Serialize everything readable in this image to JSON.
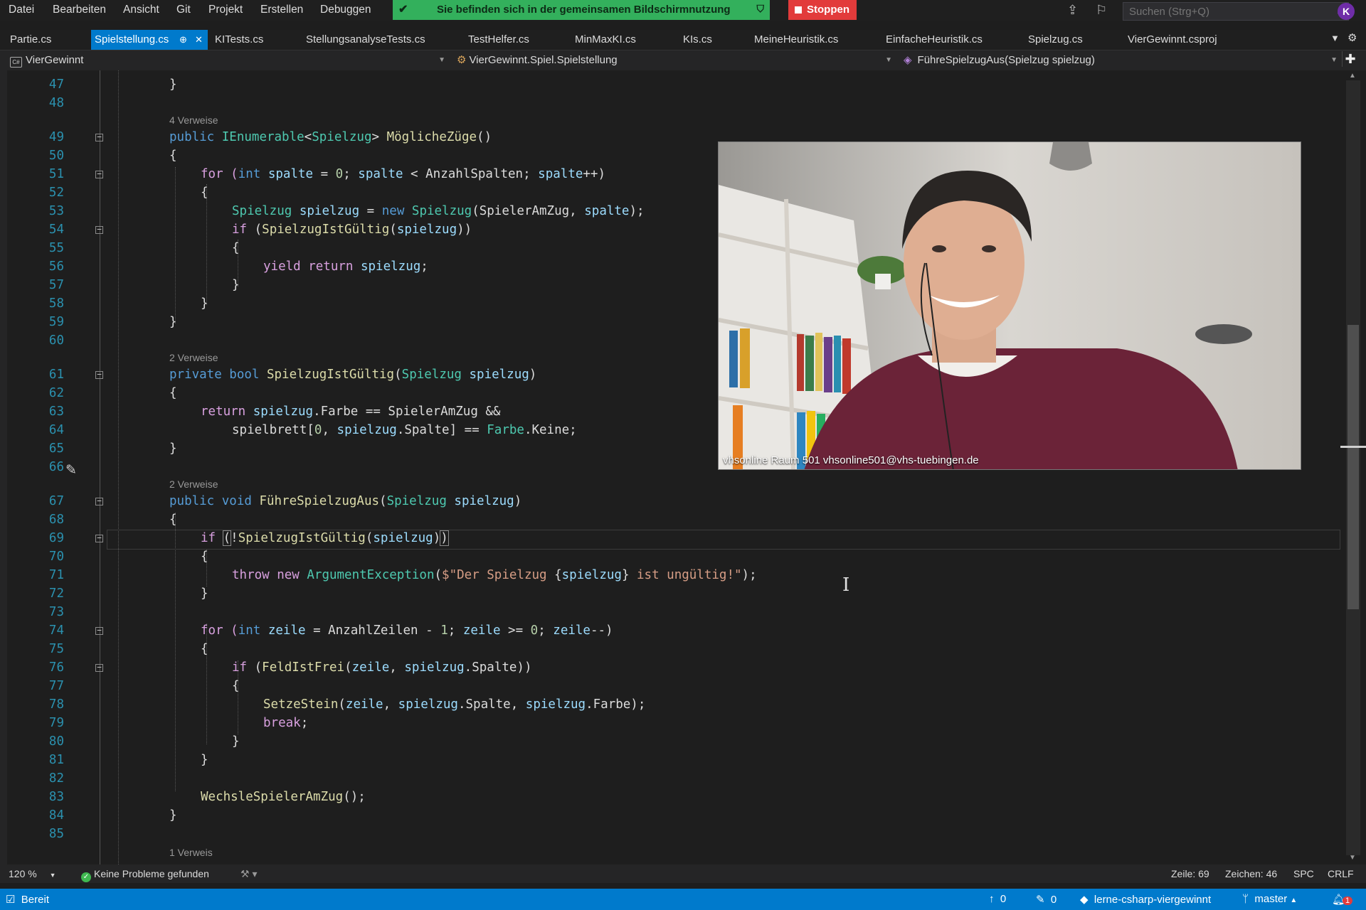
{
  "menu": [
    "Datei",
    "Bearbeiten",
    "Ansicht",
    "Git",
    "Projekt",
    "Erstellen",
    "Debuggen"
  ],
  "share_banner": {
    "text": "Sie befinden sich in der gemeinsamen Bildschirmnutzung",
    "color": "#33b05c"
  },
  "stop_button": {
    "label": "Stoppen",
    "color": "#e23b3b"
  },
  "search": {
    "placeholder": "Suchen (Strg+Q)"
  },
  "avatar": "K",
  "tabs": [
    {
      "label": "Partie.cs",
      "active": false
    },
    {
      "label": "Spielstellung.cs",
      "active": true
    },
    {
      "label": "KITests.cs",
      "active": false
    },
    {
      "label": "StellungsanalyseTests.cs",
      "active": false
    },
    {
      "label": "TestHelfer.cs",
      "active": false
    },
    {
      "label": "MinMaxKI.cs",
      "active": false
    },
    {
      "label": "KIs.cs",
      "active": false
    },
    {
      "label": "MeineHeuristik.cs",
      "active": false
    },
    {
      "label": "EinfacheHeuristik.cs",
      "active": false
    },
    {
      "label": "Spielzug.cs",
      "active": false
    },
    {
      "label": "VierGewinnt.csproj",
      "active": false
    }
  ],
  "nav": {
    "project": "VierGewinnt",
    "type": "VierGewinnt.Spiel.Spielstellung",
    "member": "FühreSpielzugAus(Spielzug spielzug)"
  },
  "editor": {
    "line_numbers": [
      "47",
      "48",
      "49",
      "50",
      "51",
      "52",
      "53",
      "54",
      "55",
      "56",
      "57",
      "58",
      "59",
      "60",
      "61",
      "62",
      "63",
      "64",
      "65",
      "66",
      "67",
      "68",
      "69",
      "70",
      "71",
      "72",
      "73",
      "74",
      "75",
      "76",
      "77",
      "78",
      "79",
      "80",
      "81",
      "82",
      "83",
      "84",
      "85"
    ],
    "codelens": [
      "4 Verweise",
      "2 Verweise",
      "2 Verweise",
      "1 Verweis"
    ],
    "code": {
      "l47": "}",
      "l49_kw": "public ",
      "l49_ty": "IEnumerable",
      "l49_lt": "<",
      "l49_ty2": "Spielzug",
      "l49_gt": "> ",
      "l49_fn": "MöglicheZüge",
      "l49_end": "()",
      "l50": "{",
      "l51_a": "for (",
      "l51_kw": "int",
      "l51_b": " ",
      "l51_v": "spalte",
      "l51_c": " = ",
      "l51_n": "0",
      "l51_d": "; ",
      "l51_v2": "spalte",
      "l51_e": " < AnzahlSpalten; ",
      "l51_v3": "spalte",
      "l51_f": "++)",
      "l52": "{",
      "l53_ty": "Spielzug",
      "l53_a": " ",
      "l53_v": "spielzug",
      "l53_b": " = ",
      "l53_kw": "new",
      "l53_c": " ",
      "l53_ty2": "Spielzug",
      "l53_d": "(SpielerAmZug, ",
      "l53_v2": "spalte",
      "l53_e": ");",
      "l54_kw": "if",
      "l54_a": " (",
      "l54_fn": "SpielzugIstGültig",
      "l54_b": "(",
      "l54_v": "spielzug",
      "l54_c": "))",
      "l55": "{",
      "l56_kw": "yield return",
      "l56_a": " ",
      "l56_v": "spielzug",
      "l56_b": ";",
      "l57": "}",
      "l58": "}",
      "l59": "}",
      "l61_kw": "private bool",
      "l61_a": " ",
      "l61_fn": "SpielzugIstGültig",
      "l61_b": "(",
      "l61_ty": "Spielzug",
      "l61_c": " ",
      "l61_v": "spielzug",
      "l61_d": ")",
      "l62": "{",
      "l63_kw": "return",
      "l63_a": " ",
      "l63_v": "spielzug",
      "l63_b": ".Farbe == SpielerAmZug &&",
      "l64_a": "spielbrett[",
      "l64_n": "0",
      "l64_b": ", ",
      "l64_v": "spielzug",
      "l64_c": ".Spalte] == ",
      "l64_ty": "Farbe",
      "l64_d": ".Keine;",
      "l65": "}",
      "l67_kw": "public void",
      "l67_a": " ",
      "l67_fn": "FühreSpielzugAus",
      "l67_b": "(",
      "l67_ty": "Spielzug",
      "l67_c": " ",
      "l67_v": "spielzug",
      "l67_d": ")",
      "l68": "{",
      "l69_kw": "if",
      "l69_a": " ",
      "l69_p": "(",
      "l69_b": "!",
      "l69_fn": "SpielzugIstGültig",
      "l69_c": "(",
      "l69_v": "spielzug",
      "l69_d": ")",
      "l69_p2": ")",
      "l70": "{",
      "l71_kw": "throw new",
      "l71_a": " ",
      "l71_ty": "ArgumentException",
      "l71_b": "(",
      "l71_s1": "$\"Der Spielzug ",
      "l71_c": "{",
      "l71_v": "spielzug",
      "l71_d": "}",
      "l71_s2": " ist ungültig!\"",
      "l71_e": ");",
      "l72": "}",
      "l74_a": "for (",
      "l74_kw": "int",
      "l74_b": " ",
      "l74_v": "zeile",
      "l74_c": " = AnzahlZeilen - ",
      "l74_n": "1",
      "l74_d": "; ",
      "l74_v2": "zeile",
      "l74_e": " >= ",
      "l74_n2": "0",
      "l74_f": "; ",
      "l74_v3": "zeile",
      "l74_g": "--)",
      "l75": "{",
      "l76_kw": "if",
      "l76_a": " (",
      "l76_fn": "FeldIstFrei",
      "l76_b": "(",
      "l76_v": "zeile",
      "l76_c": ", ",
      "l76_v2": "spielzug",
      "l76_d": ".Spalte))",
      "l77": "{",
      "l78_fn": "SetzeStein",
      "l78_a": "(",
      "l78_v": "zeile",
      "l78_b": ", ",
      "l78_v2": "spielzug",
      "l78_c": ".Spalte, ",
      "l78_v3": "spielzug",
      "l78_d": ".Farbe);",
      "l79_kw": "break",
      "l79_a": ";",
      "l80": "}",
      "l81": "}",
      "l83_fn": "WechsleSpielerAmZug",
      "l83_a": "();",
      "l84": "}"
    }
  },
  "video": {
    "caption": "vhsonline Raum 501 vhsonline501@vhs-tuebingen.de"
  },
  "editor_status": {
    "zoom": "120 %",
    "issues": "Keine Probleme gefunden",
    "line": "Zeile: 69",
    "column": "Zeichen: 46",
    "whitespace": "SPC",
    "line_ending": "CRLF"
  },
  "status": {
    "ready": "Bereit",
    "push_count": "0",
    "pencil_count": "0",
    "repo": "lerne-csharp-viergewinnt",
    "branch": "master",
    "notification_count": "1"
  },
  "colors": {
    "accent": "#007acc",
    "line_number": "#2b91af",
    "keyword": "#569cd6",
    "type": "#4ec9b0",
    "method": "#dcdcaa",
    "param": "#9cdcfe",
    "string": "#d69d85"
  }
}
